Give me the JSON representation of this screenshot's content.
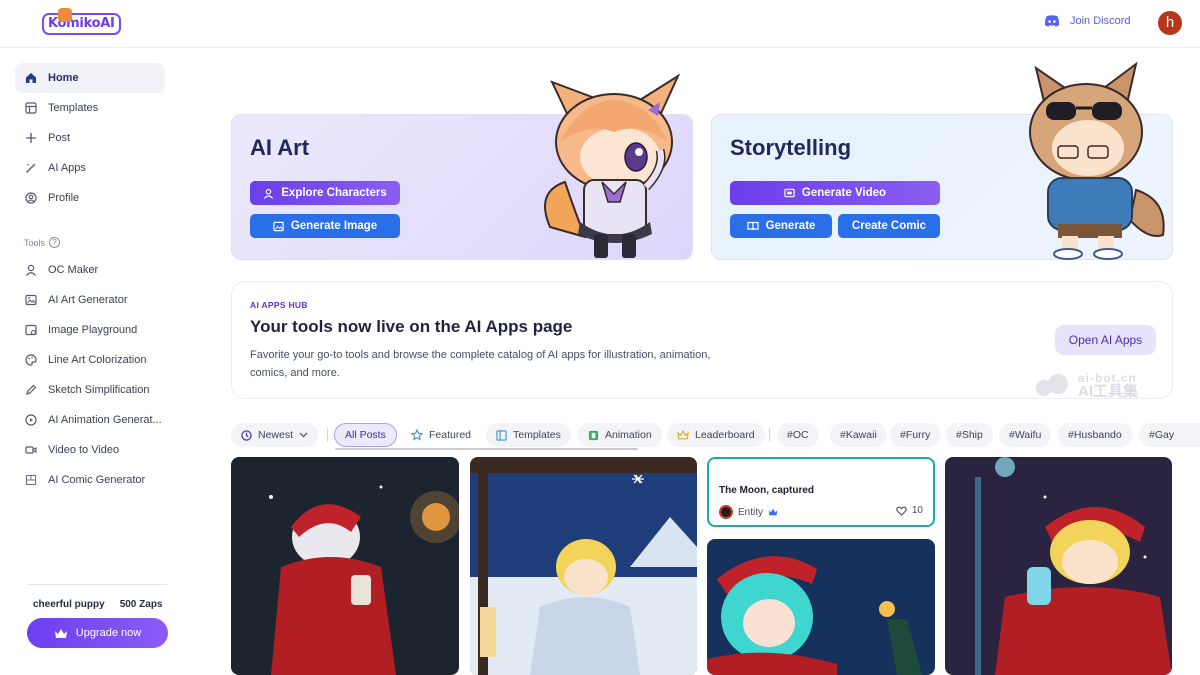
{
  "header": {
    "logo_text": "KomikoAI",
    "discord_label": "Join Discord",
    "avatar_letter": "h"
  },
  "sidebar": {
    "items": [
      {
        "label": "Home",
        "icon": "home-icon",
        "active": true
      },
      {
        "label": "Templates",
        "icon": "templates-icon"
      },
      {
        "label": "Post",
        "icon": "plus-icon"
      },
      {
        "label": "AI Apps",
        "icon": "magic-wand-icon"
      },
      {
        "label": "Profile",
        "icon": "profile-icon"
      }
    ],
    "tools_label": "Tools",
    "tools": [
      {
        "label": "OC Maker",
        "icon": "user-icon"
      },
      {
        "label": "AI Art Generator",
        "icon": "image-icon"
      },
      {
        "label": "Image Playground",
        "icon": "playground-icon"
      },
      {
        "label": "Line Art Colorization",
        "icon": "palette-icon"
      },
      {
        "label": "Sketch Simplification",
        "icon": "pen-icon"
      },
      {
        "label": "AI Animation Generat...",
        "icon": "play-circle-icon"
      },
      {
        "label": "Video to Video",
        "icon": "video-icon"
      },
      {
        "label": "AI Comic Generator",
        "icon": "comic-icon"
      }
    ],
    "user_name": "cheerful puppy",
    "zaps": "500 Zaps",
    "upgrade_label": "Upgrade now"
  },
  "hero": {
    "left": {
      "title": "AI Art",
      "btn_explore": "Explore Characters",
      "btn_generate_image": "Generate Image"
    },
    "right": {
      "title": "Storytelling",
      "btn_generate_video": "Generate Video",
      "btn_generate": "Generate",
      "btn_create_comic": "Create Comic"
    }
  },
  "hub": {
    "eyebrow": "AI APPS HUB",
    "title": "Your tools now live on the AI Apps page",
    "description": "Favorite your go-to tools and browse the complete catalog of AI apps for illustration, animation, comics, and more.",
    "button": "Open AI Apps"
  },
  "watermark": {
    "line1": "ai-bot.cn",
    "line2": "AI工具集"
  },
  "filters": {
    "sort": "Newest",
    "chips": [
      "All Posts",
      "Featured",
      "Templates",
      "Animation",
      "Leaderboard"
    ],
    "tags": [
      "#OC",
      "#Kawaii",
      "#Furry",
      "#Ship",
      "#Waifu",
      "#Husbando",
      "#Gay"
    ]
  },
  "gallery": {
    "text_post": {
      "title": "The Moon, captured",
      "author": "Entity",
      "likes": "10"
    }
  },
  "colors": {
    "accent_purple": "#6b3ff0",
    "accent_blue": "#2a6ee8",
    "teal_border": "#22a8a8"
  }
}
